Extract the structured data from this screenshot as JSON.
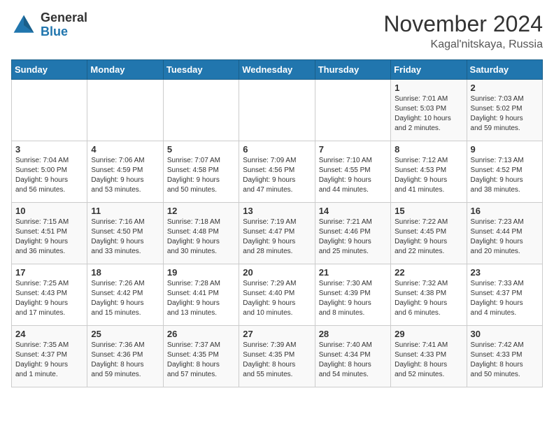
{
  "logo": {
    "general": "General",
    "blue": "Blue"
  },
  "title": "November 2024",
  "location": "Kagal'nitskaya, Russia",
  "days_of_week": [
    "Sunday",
    "Monday",
    "Tuesday",
    "Wednesday",
    "Thursday",
    "Friday",
    "Saturday"
  ],
  "weeks": [
    [
      {
        "day": "",
        "info": ""
      },
      {
        "day": "",
        "info": ""
      },
      {
        "day": "",
        "info": ""
      },
      {
        "day": "",
        "info": ""
      },
      {
        "day": "",
        "info": ""
      },
      {
        "day": "1",
        "info": "Sunrise: 7:01 AM\nSunset: 5:03 PM\nDaylight: 10 hours\nand 2 minutes."
      },
      {
        "day": "2",
        "info": "Sunrise: 7:03 AM\nSunset: 5:02 PM\nDaylight: 9 hours\nand 59 minutes."
      }
    ],
    [
      {
        "day": "3",
        "info": "Sunrise: 7:04 AM\nSunset: 5:00 PM\nDaylight: 9 hours\nand 56 minutes."
      },
      {
        "day": "4",
        "info": "Sunrise: 7:06 AM\nSunset: 4:59 PM\nDaylight: 9 hours\nand 53 minutes."
      },
      {
        "day": "5",
        "info": "Sunrise: 7:07 AM\nSunset: 4:58 PM\nDaylight: 9 hours\nand 50 minutes."
      },
      {
        "day": "6",
        "info": "Sunrise: 7:09 AM\nSunset: 4:56 PM\nDaylight: 9 hours\nand 47 minutes."
      },
      {
        "day": "7",
        "info": "Sunrise: 7:10 AM\nSunset: 4:55 PM\nDaylight: 9 hours\nand 44 minutes."
      },
      {
        "day": "8",
        "info": "Sunrise: 7:12 AM\nSunset: 4:53 PM\nDaylight: 9 hours\nand 41 minutes."
      },
      {
        "day": "9",
        "info": "Sunrise: 7:13 AM\nSunset: 4:52 PM\nDaylight: 9 hours\nand 38 minutes."
      }
    ],
    [
      {
        "day": "10",
        "info": "Sunrise: 7:15 AM\nSunset: 4:51 PM\nDaylight: 9 hours\nand 36 minutes."
      },
      {
        "day": "11",
        "info": "Sunrise: 7:16 AM\nSunset: 4:50 PM\nDaylight: 9 hours\nand 33 minutes."
      },
      {
        "day": "12",
        "info": "Sunrise: 7:18 AM\nSunset: 4:48 PM\nDaylight: 9 hours\nand 30 minutes."
      },
      {
        "day": "13",
        "info": "Sunrise: 7:19 AM\nSunset: 4:47 PM\nDaylight: 9 hours\nand 28 minutes."
      },
      {
        "day": "14",
        "info": "Sunrise: 7:21 AM\nSunset: 4:46 PM\nDaylight: 9 hours\nand 25 minutes."
      },
      {
        "day": "15",
        "info": "Sunrise: 7:22 AM\nSunset: 4:45 PM\nDaylight: 9 hours\nand 22 minutes."
      },
      {
        "day": "16",
        "info": "Sunrise: 7:23 AM\nSunset: 4:44 PM\nDaylight: 9 hours\nand 20 minutes."
      }
    ],
    [
      {
        "day": "17",
        "info": "Sunrise: 7:25 AM\nSunset: 4:43 PM\nDaylight: 9 hours\nand 17 minutes."
      },
      {
        "day": "18",
        "info": "Sunrise: 7:26 AM\nSunset: 4:42 PM\nDaylight: 9 hours\nand 15 minutes."
      },
      {
        "day": "19",
        "info": "Sunrise: 7:28 AM\nSunset: 4:41 PM\nDaylight: 9 hours\nand 13 minutes."
      },
      {
        "day": "20",
        "info": "Sunrise: 7:29 AM\nSunset: 4:40 PM\nDaylight: 9 hours\nand 10 minutes."
      },
      {
        "day": "21",
        "info": "Sunrise: 7:30 AM\nSunset: 4:39 PM\nDaylight: 9 hours\nand 8 minutes."
      },
      {
        "day": "22",
        "info": "Sunrise: 7:32 AM\nSunset: 4:38 PM\nDaylight: 9 hours\nand 6 minutes."
      },
      {
        "day": "23",
        "info": "Sunrise: 7:33 AM\nSunset: 4:37 PM\nDaylight: 9 hours\nand 4 minutes."
      }
    ],
    [
      {
        "day": "24",
        "info": "Sunrise: 7:35 AM\nSunset: 4:37 PM\nDaylight: 9 hours\nand 1 minute."
      },
      {
        "day": "25",
        "info": "Sunrise: 7:36 AM\nSunset: 4:36 PM\nDaylight: 8 hours\nand 59 minutes."
      },
      {
        "day": "26",
        "info": "Sunrise: 7:37 AM\nSunset: 4:35 PM\nDaylight: 8 hours\nand 57 minutes."
      },
      {
        "day": "27",
        "info": "Sunrise: 7:39 AM\nSunset: 4:35 PM\nDaylight: 8 hours\nand 55 minutes."
      },
      {
        "day": "28",
        "info": "Sunrise: 7:40 AM\nSunset: 4:34 PM\nDaylight: 8 hours\nand 54 minutes."
      },
      {
        "day": "29",
        "info": "Sunrise: 7:41 AM\nSunset: 4:33 PM\nDaylight: 8 hours\nand 52 minutes."
      },
      {
        "day": "30",
        "info": "Sunrise: 7:42 AM\nSunset: 4:33 PM\nDaylight: 8 hours\nand 50 minutes."
      }
    ]
  ]
}
